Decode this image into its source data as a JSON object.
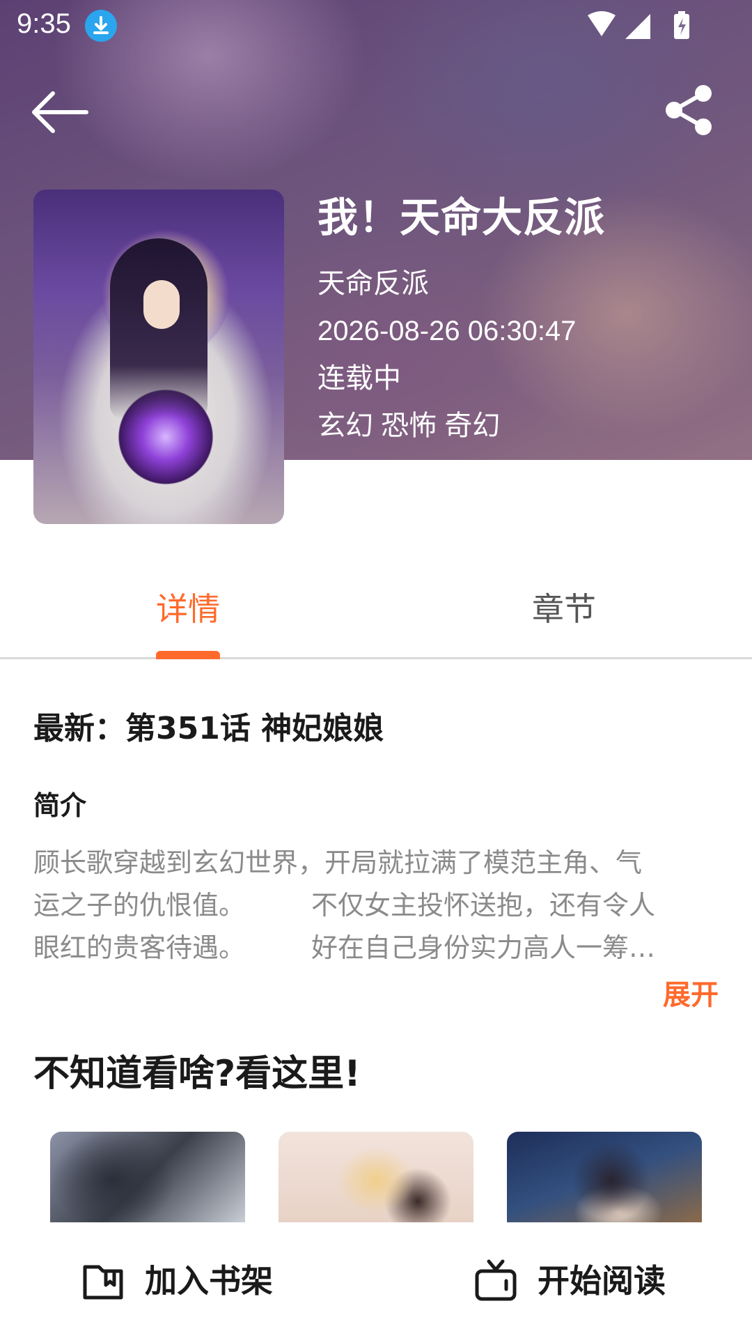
{
  "status_bar": {
    "time": "9:35"
  },
  "book": {
    "title": "我！天命大反派",
    "author": "天命反派",
    "updated": "2026-08-26 06:30:47",
    "status": "连载中",
    "genres": "玄幻 恐怖 奇幻"
  },
  "tabs": [
    {
      "label": "详情",
      "active": true
    },
    {
      "label": "章节",
      "active": false
    }
  ],
  "detail": {
    "latest": "最新：第351话 神妃娘娘",
    "intro_heading": "简介",
    "intro_lines": [
      "顾长歌穿越到玄幻世界，开局就拉满了模范主角、气",
      "运之子的仇恨值。　　　不仅女主投怀送抱，还有令人",
      "眼红的贵客待遇。　　　好在自己身份实力高人一筹…"
    ],
    "expand_label": "展开"
  },
  "recommend": {
    "title": "不知道看啥?看这里!"
  },
  "bottom_bar": {
    "add_shelf_label": "加入书架",
    "start_read_label": "开始阅读"
  },
  "colors": {
    "accent": "#ff6a2c",
    "text_primary": "#1a1a1a",
    "text_secondary": "#8a8a8a"
  },
  "icons": {
    "back": "arrow-left-icon",
    "share": "share-icon",
    "download": "download-icon",
    "wifi": "wifi-icon",
    "signal": "signal-icon",
    "battery": "battery-icon",
    "bookshelf": "book-icon",
    "read": "tv-icon"
  }
}
